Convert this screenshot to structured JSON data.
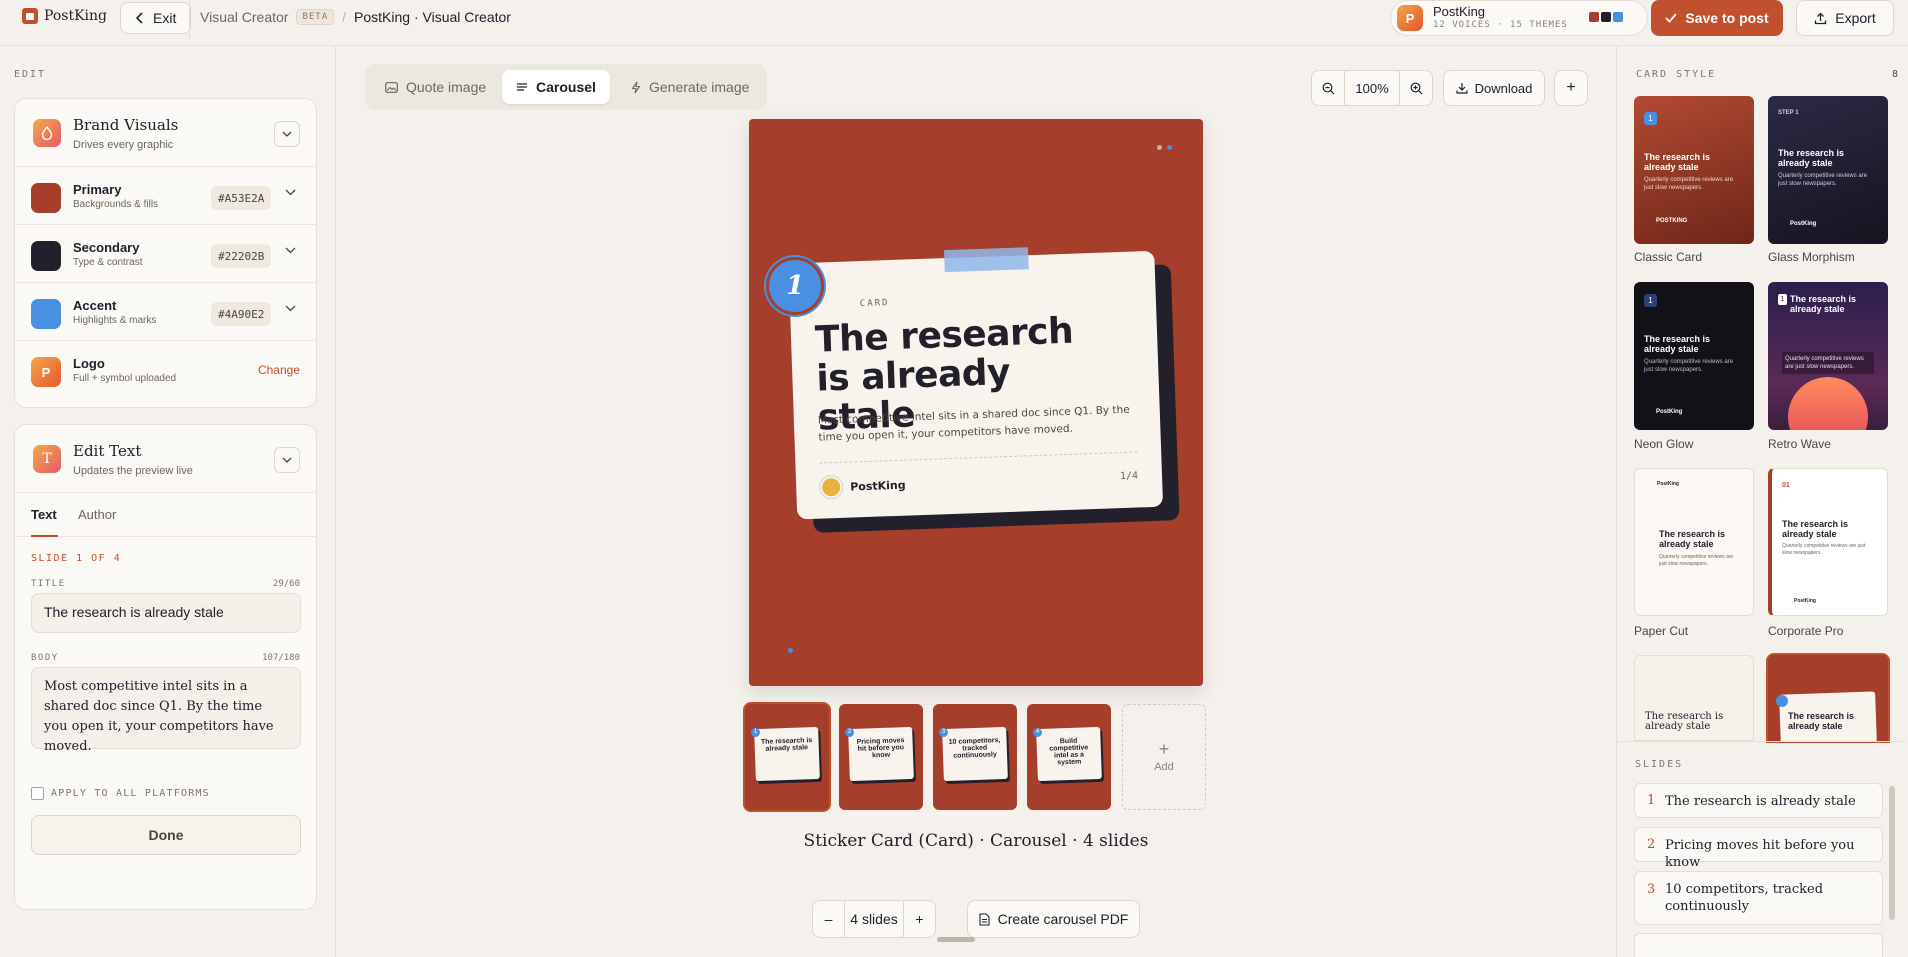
{
  "app": {
    "name": "PostKing",
    "exit_label": "Exit",
    "crumb_section": "Visual Creator",
    "beta": "BETA",
    "crumb_page": "PostKing · Visual Creator"
  },
  "brand_pill": {
    "initial": "P",
    "name": "PostKing",
    "stats": "12 VOICES · 15 THEMES",
    "swatches": [
      "#A53E2A",
      "#22202B",
      "#4A90E2"
    ]
  },
  "header_actions": {
    "save": "Save to post",
    "export": "Export"
  },
  "left": {
    "section_label": "EDIT",
    "brand_visuals": {
      "title": "Brand Visuals",
      "subtitle": "Drives every graphic"
    },
    "colors": [
      {
        "name": "Primary",
        "desc": "Backgrounds & fills",
        "hex": "#A53E2A"
      },
      {
        "name": "Secondary",
        "desc": "Type & contrast",
        "hex": "#22202B"
      },
      {
        "name": "Accent",
        "desc": "Highlights & marks",
        "hex": "#4A90E2"
      }
    ],
    "logo": {
      "initial": "P",
      "name": "Logo",
      "desc": "Full + symbol uploaded",
      "action": "Change"
    },
    "edit_text": {
      "title": "Edit Text",
      "subtitle": "Updates the preview live",
      "icon_letter": "T"
    },
    "tabs": [
      "Text",
      "Author"
    ],
    "slide_indicator": "SLIDE 1 OF 4",
    "title_label": "TITLE",
    "title_count": "29/60",
    "title_value": "The research is already stale",
    "body_label": "BODY",
    "body_count": "107/180",
    "body_value": "Most competitive intel sits in a shared doc since Q1. By the time you open it, your competitors have moved.",
    "apply_all": "APPLY TO ALL PLATFORMS",
    "done": "Done"
  },
  "center": {
    "modes": [
      "Quote image",
      "Carousel",
      "Generate image"
    ],
    "active_mode": "Carousel",
    "zoom": "100%",
    "download": "Download",
    "slide": {
      "number": "1",
      "eyebrow": "CARD",
      "title": "The research is already stale",
      "body": "Most competitive intel sits in a shared doc since Q1. By the time you open it, your competitors have moved.",
      "author": "PostKing",
      "page": "1/4"
    },
    "thumbs": [
      {
        "n": "1",
        "title": "The research is already stale"
      },
      {
        "n": "2",
        "title": "Pricing moves hit before you know"
      },
      {
        "n": "3",
        "title": "10 competitors, tracked continuously"
      },
      {
        "n": "4",
        "title": "Build competitive intel as a system"
      }
    ],
    "add_label": "Add",
    "caption": "Sticker Card (Card) · Carousel · 4 slides",
    "slide_count": "4 slides",
    "minus": "–",
    "plus": "+",
    "pdf": "Create carousel PDF"
  },
  "right": {
    "card_style_label": "CARD STYLE",
    "card_style_count": "8",
    "styles": [
      {
        "name": "Classic Card",
        "preview_title": "The research is already stale",
        "preview_body": "Quarterly competitive reviews are just slow newspapers.",
        "brand": "POSTKING",
        "tag": "1"
      },
      {
        "name": "Glass Morphism",
        "preview_title": "The research is already stale",
        "preview_body": "Quarterly competitive reviews are just slow newspapers.",
        "brand": "PostKing",
        "tag": "STEP 1"
      },
      {
        "name": "Neon Glow",
        "preview_title": "The research is already stale",
        "preview_body": "Quarterly competitive reviews are just slow newspapers.",
        "brand": "PostKing",
        "tag": "1"
      },
      {
        "name": "Retro Wave",
        "preview_title": "The research is already stale",
        "preview_body": "Quarterly competitive reviews are just slow newspapers.",
        "brand": "",
        "tag": "1"
      },
      {
        "name": "Paper Cut",
        "preview_title": "The research is already stale",
        "preview_body": "Quarterly competitive reviews are just slow newspapers.",
        "brand": "PostKing",
        "tag": ""
      },
      {
        "name": "Corporate Pro",
        "preview_title": "The research is already stale",
        "preview_body": "Quarterly competitive reviews are just slow newspapers.",
        "brand": "PostKing",
        "tag": "01"
      },
      {
        "name": "",
        "preview_title": "The research is already stale",
        "preview_body": "",
        "brand": "",
        "tag": ""
      },
      {
        "name": "",
        "preview_title": "The research is already stale",
        "preview_body": "",
        "brand": "",
        "tag": ""
      }
    ],
    "slides_label": "SLIDES",
    "slides": [
      {
        "n": "1",
        "title": "The research is already stale"
      },
      {
        "n": "2",
        "title": "Pricing moves hit before you know"
      },
      {
        "n": "3",
        "title": "10 competitors, tracked continuously"
      }
    ]
  }
}
